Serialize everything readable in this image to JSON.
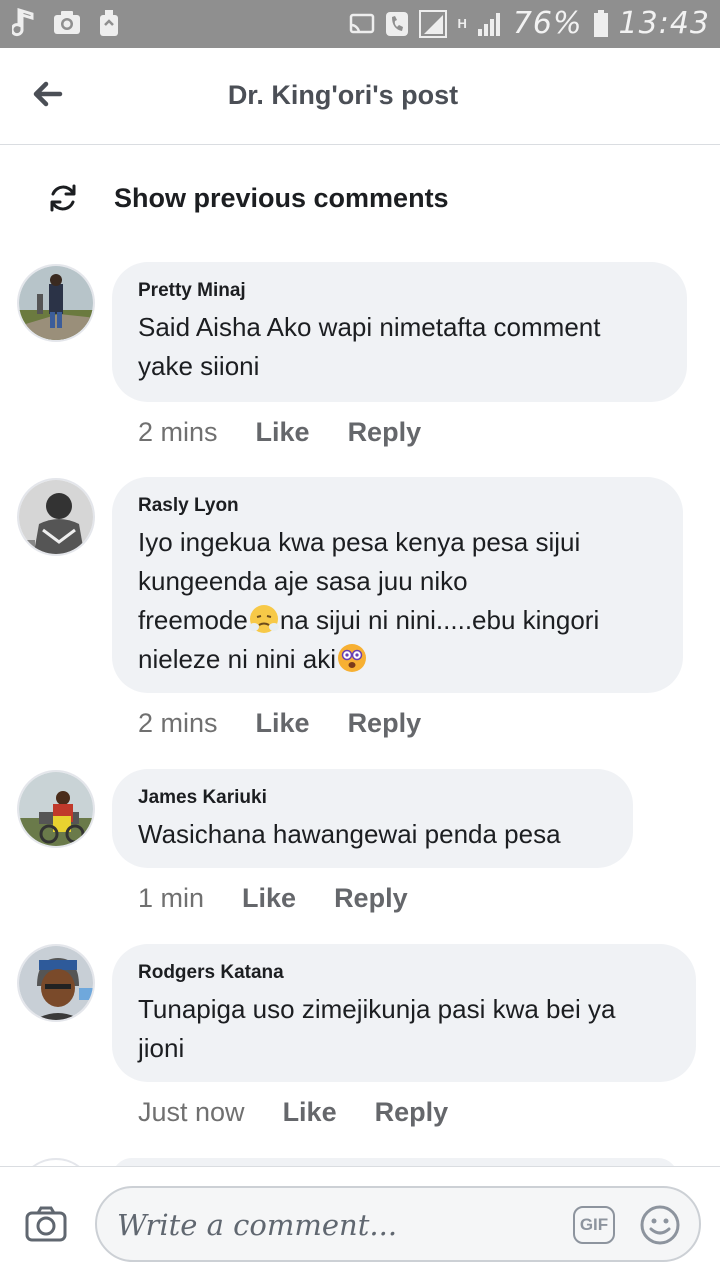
{
  "status_bar": {
    "battery": "76%",
    "time": "13:43",
    "network": "H"
  },
  "header": {
    "title": "Dr. King'ori's post"
  },
  "previous": {
    "label": "Show previous comments"
  },
  "comments": [
    {
      "author": "Pretty Minaj",
      "lines": [
        "Said Aisha Ako wapi nimetafta comment",
        "yake siioni"
      ],
      "time": "2 mins",
      "like": "Like",
      "reply": "Reply"
    },
    {
      "author": "Rasly Lyon",
      "lines": [
        "Iyo ingekua kwa pesa kenya pesa sijui",
        "kungeenda aje sasa juu niko",
        "freemode",
        "na sijui ni nini.....ebu kingori",
        "nieleze ni nini aki"
      ],
      "time": "2 mins",
      "like": "Like",
      "reply": "Reply"
    },
    {
      "author": "James Kariuki",
      "lines": [
        "Wasichana hawangewai penda pesa"
      ],
      "time": "1 min",
      "like": "Like",
      "reply": "Reply"
    },
    {
      "author": "Rodgers Katana",
      "lines": [
        "Tunapiga uso zimejikunja pasi kwa bei ya",
        "jioni"
      ],
      "time": "Just now",
      "like": "Like",
      "reply": "Reply"
    }
  ],
  "composer": {
    "placeholder": "Write a comment...",
    "gif_label": "GIF"
  },
  "colors": {
    "bubble": "#f0f2f5",
    "status_bar": "#8f8f8f",
    "meta_text": "#65676b"
  }
}
